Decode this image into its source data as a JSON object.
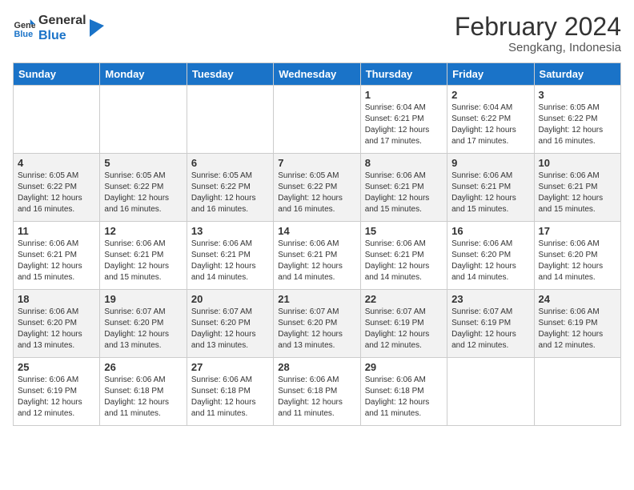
{
  "header": {
    "logo_line1": "General",
    "logo_line2": "Blue",
    "month_year": "February 2024",
    "location": "Sengkang, Indonesia"
  },
  "days_of_week": [
    "Sunday",
    "Monday",
    "Tuesday",
    "Wednesday",
    "Thursday",
    "Friday",
    "Saturday"
  ],
  "weeks": [
    [
      {
        "day": "",
        "info": ""
      },
      {
        "day": "",
        "info": ""
      },
      {
        "day": "",
        "info": ""
      },
      {
        "day": "",
        "info": ""
      },
      {
        "day": "1",
        "info": "Sunrise: 6:04 AM\nSunset: 6:21 PM\nDaylight: 12 hours and 17 minutes."
      },
      {
        "day": "2",
        "info": "Sunrise: 6:04 AM\nSunset: 6:22 PM\nDaylight: 12 hours and 17 minutes."
      },
      {
        "day": "3",
        "info": "Sunrise: 6:05 AM\nSunset: 6:22 PM\nDaylight: 12 hours and 16 minutes."
      }
    ],
    [
      {
        "day": "4",
        "info": "Sunrise: 6:05 AM\nSunset: 6:22 PM\nDaylight: 12 hours and 16 minutes."
      },
      {
        "day": "5",
        "info": "Sunrise: 6:05 AM\nSunset: 6:22 PM\nDaylight: 12 hours and 16 minutes."
      },
      {
        "day": "6",
        "info": "Sunrise: 6:05 AM\nSunset: 6:22 PM\nDaylight: 12 hours and 16 minutes."
      },
      {
        "day": "7",
        "info": "Sunrise: 6:05 AM\nSunset: 6:22 PM\nDaylight: 12 hours and 16 minutes."
      },
      {
        "day": "8",
        "info": "Sunrise: 6:06 AM\nSunset: 6:21 PM\nDaylight: 12 hours and 15 minutes."
      },
      {
        "day": "9",
        "info": "Sunrise: 6:06 AM\nSunset: 6:21 PM\nDaylight: 12 hours and 15 minutes."
      },
      {
        "day": "10",
        "info": "Sunrise: 6:06 AM\nSunset: 6:21 PM\nDaylight: 12 hours and 15 minutes."
      }
    ],
    [
      {
        "day": "11",
        "info": "Sunrise: 6:06 AM\nSunset: 6:21 PM\nDaylight: 12 hours and 15 minutes."
      },
      {
        "day": "12",
        "info": "Sunrise: 6:06 AM\nSunset: 6:21 PM\nDaylight: 12 hours and 15 minutes."
      },
      {
        "day": "13",
        "info": "Sunrise: 6:06 AM\nSunset: 6:21 PM\nDaylight: 12 hours and 14 minutes."
      },
      {
        "day": "14",
        "info": "Sunrise: 6:06 AM\nSunset: 6:21 PM\nDaylight: 12 hours and 14 minutes."
      },
      {
        "day": "15",
        "info": "Sunrise: 6:06 AM\nSunset: 6:21 PM\nDaylight: 12 hours and 14 minutes."
      },
      {
        "day": "16",
        "info": "Sunrise: 6:06 AM\nSunset: 6:20 PM\nDaylight: 12 hours and 14 minutes."
      },
      {
        "day": "17",
        "info": "Sunrise: 6:06 AM\nSunset: 6:20 PM\nDaylight: 12 hours and 14 minutes."
      }
    ],
    [
      {
        "day": "18",
        "info": "Sunrise: 6:06 AM\nSunset: 6:20 PM\nDaylight: 12 hours and 13 minutes."
      },
      {
        "day": "19",
        "info": "Sunrise: 6:07 AM\nSunset: 6:20 PM\nDaylight: 12 hours and 13 minutes."
      },
      {
        "day": "20",
        "info": "Sunrise: 6:07 AM\nSunset: 6:20 PM\nDaylight: 12 hours and 13 minutes."
      },
      {
        "day": "21",
        "info": "Sunrise: 6:07 AM\nSunset: 6:20 PM\nDaylight: 12 hours and 13 minutes."
      },
      {
        "day": "22",
        "info": "Sunrise: 6:07 AM\nSunset: 6:19 PM\nDaylight: 12 hours and 12 minutes."
      },
      {
        "day": "23",
        "info": "Sunrise: 6:07 AM\nSunset: 6:19 PM\nDaylight: 12 hours and 12 minutes."
      },
      {
        "day": "24",
        "info": "Sunrise: 6:06 AM\nSunset: 6:19 PM\nDaylight: 12 hours and 12 minutes."
      }
    ],
    [
      {
        "day": "25",
        "info": "Sunrise: 6:06 AM\nSunset: 6:19 PM\nDaylight: 12 hours and 12 minutes."
      },
      {
        "day": "26",
        "info": "Sunrise: 6:06 AM\nSunset: 6:18 PM\nDaylight: 12 hours and 11 minutes."
      },
      {
        "day": "27",
        "info": "Sunrise: 6:06 AM\nSunset: 6:18 PM\nDaylight: 12 hours and 11 minutes."
      },
      {
        "day": "28",
        "info": "Sunrise: 6:06 AM\nSunset: 6:18 PM\nDaylight: 12 hours and 11 minutes."
      },
      {
        "day": "29",
        "info": "Sunrise: 6:06 AM\nSunset: 6:18 PM\nDaylight: 12 hours and 11 minutes."
      },
      {
        "day": "",
        "info": ""
      },
      {
        "day": "",
        "info": ""
      }
    ]
  ]
}
